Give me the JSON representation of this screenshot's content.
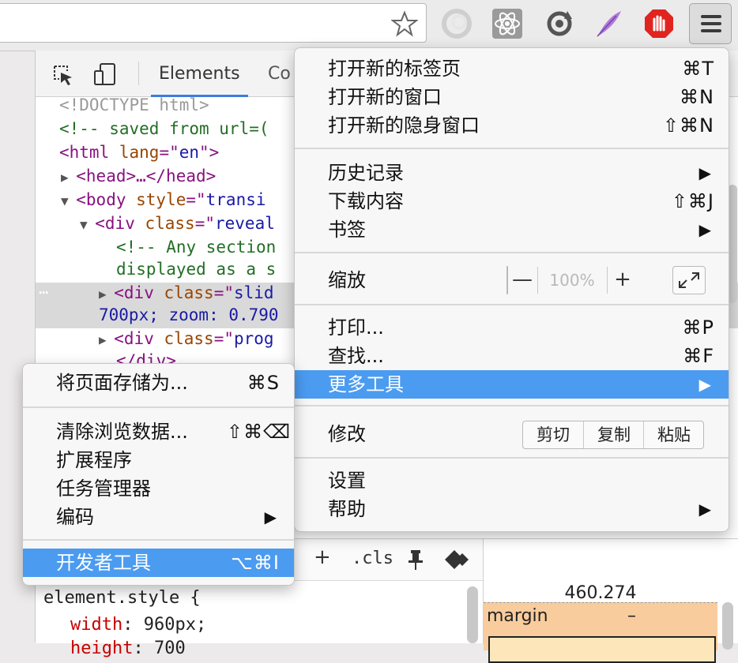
{
  "devtools": {
    "tab_elements": "Elements",
    "tab_console": "Co",
    "dom_lines": {
      "l1": "<!DOCTYPE html>",
      "l2": "<!-- saved from url=(",
      "l3_tag": "<html ",
      "l3_attr": "lang",
      "l3_eq": "=\"",
      "l3_val": "en",
      "l3_end": "\">",
      "l4": "<head>…</head>",
      "l5_tag": "<body ",
      "l5_attr": "style",
      "l5_eq": "=\"",
      "l5_val": "transi",
      "l6_tag": "<div ",
      "l6_attr": "class",
      "l6_eq": "=\"",
      "l6_val": "reveal",
      "l7": "<!-- Any section",
      "l8": "displayed as a s",
      "l9_tag": "<div ",
      "l9_attr": "class",
      "l9_eq": "=\"",
      "l9_val": "slid",
      "l10": "700px; zoom: 0.790",
      "l11_tag": "<div ",
      "l11_attr": "class",
      "l11_eq": "=\"",
      "l11_val": "prog",
      "l12": "</div>",
      "dots": "⋯"
    },
    "styles": {
      "plus": "+",
      "cls": ".cls",
      "selector": "element.style {",
      "prop1_name": "width",
      "prop1_value": "960px;",
      "prop2_name": "height",
      "prop2_value": "700"
    },
    "box_model": {
      "width": "460.274",
      "margin_label": "margin",
      "margin_value": "–"
    }
  },
  "main_menu": {
    "new_tab": {
      "label": "打开新的标签页",
      "shortcut": "⌘T"
    },
    "new_window": {
      "label": "打开新的窗口",
      "shortcut": "⌘N"
    },
    "new_incognito": {
      "label": "打开新的隐身窗口",
      "shortcut": "⇧⌘N"
    },
    "history": {
      "label": "历史记录",
      "arrow": "▶"
    },
    "downloads": {
      "label": "下载内容",
      "shortcut": "⇧⌘J"
    },
    "bookmarks": {
      "label": "书签",
      "arrow": "▶"
    },
    "zoom": {
      "label": "缩放",
      "minus": "—",
      "value": "100%",
      "plus": "+"
    },
    "print": {
      "label": "打印...",
      "shortcut": "⌘P"
    },
    "find": {
      "label": "查找...",
      "shortcut": "⌘F"
    },
    "more_tools": {
      "label": "更多工具",
      "arrow": "▶"
    },
    "edit": {
      "label": "修改",
      "cut": "剪切",
      "copy": "复制",
      "paste": "粘贴"
    },
    "settings": {
      "label": "设置"
    },
    "help": {
      "label": "帮助",
      "arrow": "▶"
    }
  },
  "sub_menu": {
    "save_page": {
      "label": "将页面存储为...",
      "shortcut": "⌘S"
    },
    "clear_data": {
      "label": "清除浏览数据...",
      "shortcut": "⇧⌘⌫"
    },
    "extensions": {
      "label": "扩展程序"
    },
    "task_manager": {
      "label": "任务管理器"
    },
    "encoding": {
      "label": "编码",
      "arrow": "▶"
    },
    "developer_tools": {
      "label": "开发者工具",
      "shortcut": "⌥⌘I"
    }
  },
  "colors": {
    "highlight": "#4b9bf0",
    "tag": "#881280",
    "attribute": "#994500",
    "value": "#1a1aa6",
    "comment": "#236e25",
    "margin_box": "#f9cc9d"
  }
}
